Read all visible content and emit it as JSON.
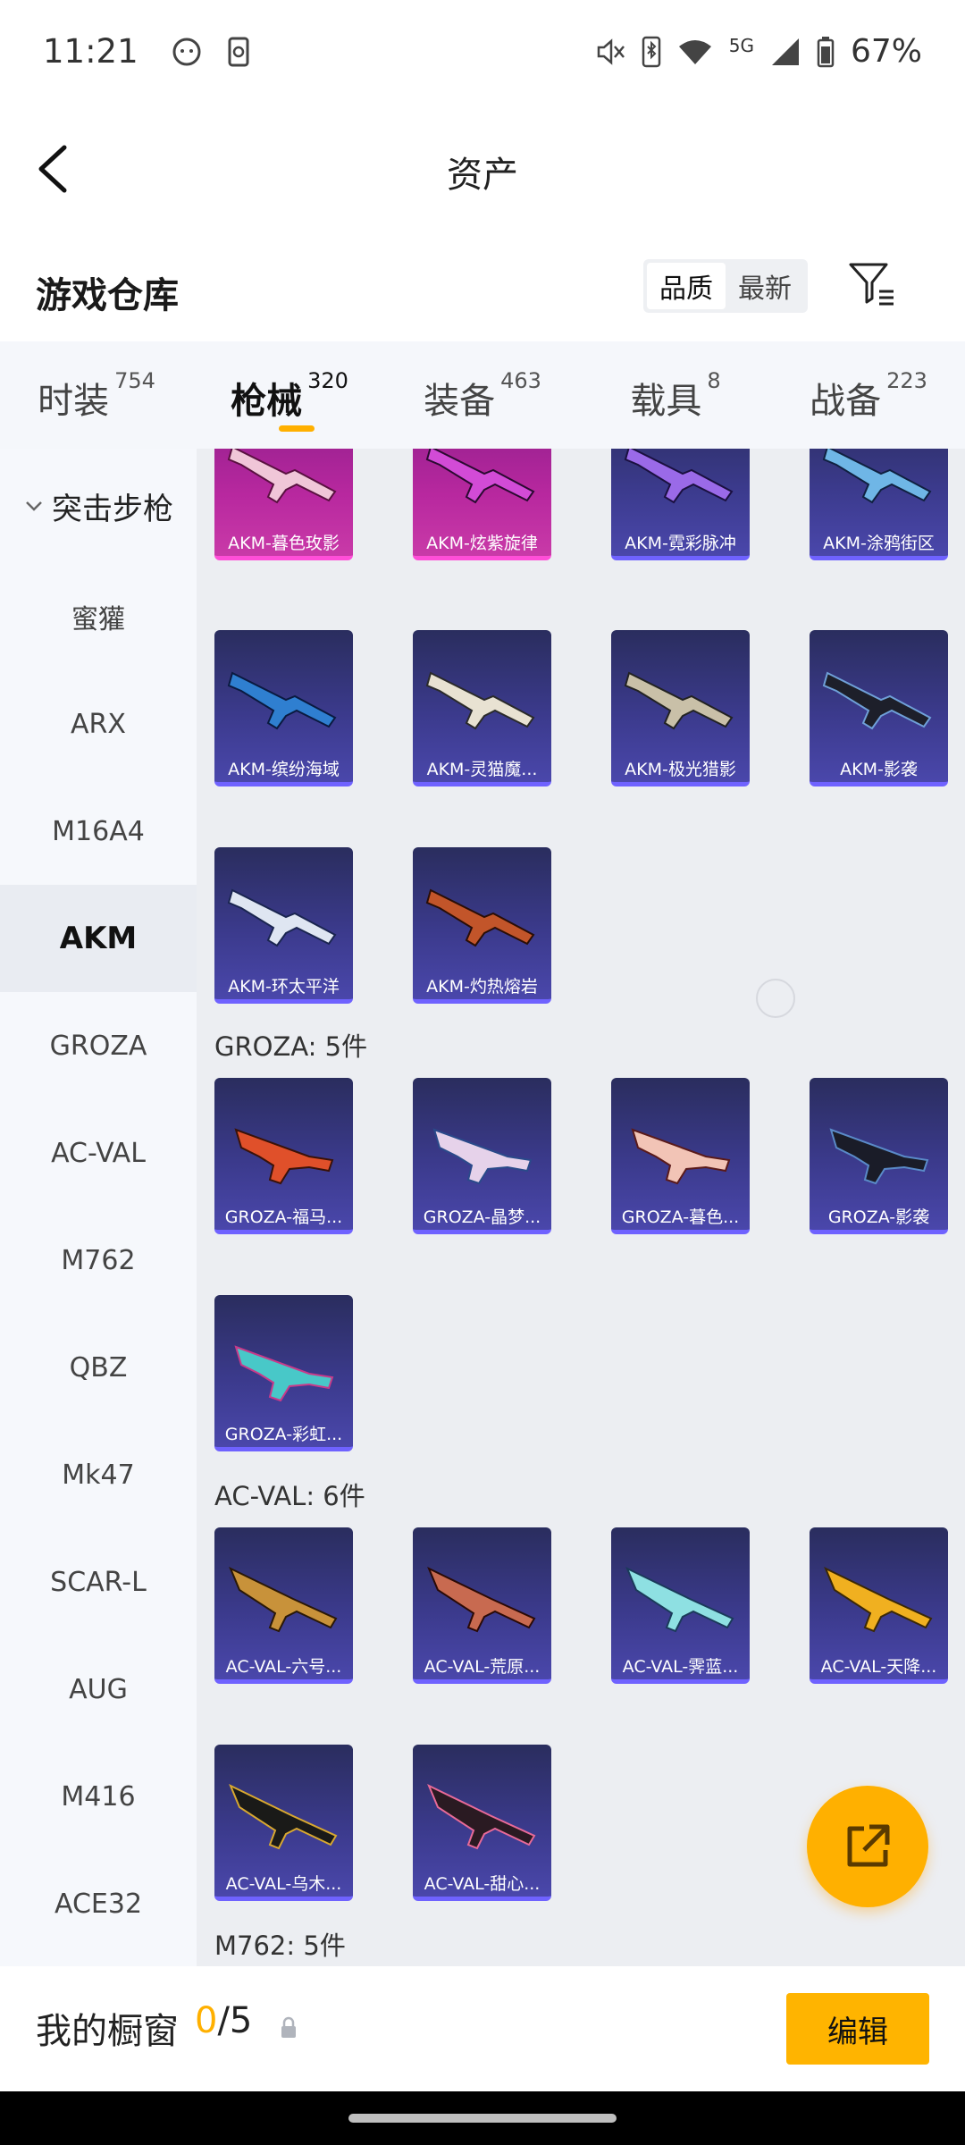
{
  "status_bar": {
    "time": "11:21",
    "network": "5G",
    "battery": "67%"
  },
  "header": {
    "title": "资产",
    "back_icon": "chevron-left-icon"
  },
  "warehouse": {
    "title": "游戏仓库",
    "sort_options": [
      "品质",
      "最新"
    ],
    "active_sort": "品质",
    "filter_icon": "filter-list-icon"
  },
  "tabs": [
    {
      "label": "时装",
      "count": "754"
    },
    {
      "label": "枪械",
      "count": "320",
      "active": true
    },
    {
      "label": "装备",
      "count": "463"
    },
    {
      "label": "载具",
      "count": "8"
    },
    {
      "label": "战备",
      "count": "223"
    }
  ],
  "sidebar": {
    "category": "突击步枪",
    "items": [
      "蜜獾",
      "ARX",
      "M16A4",
      "AKM",
      "GROZA",
      "AC-VAL",
      "M762",
      "QBZ",
      "Mk47",
      "SCAR-L",
      "AUG",
      "M416",
      "ACE32"
    ],
    "active": "AKM"
  },
  "content": {
    "akm_partial_row": [
      "AKM-暮色玫影",
      "AKM-炫紫旋律",
      "AKM-霓彩脉冲",
      "AKM-涂鸦街区"
    ],
    "akm_row2": [
      "AKM-缤纷海域",
      "AKM-灵猫魔...",
      "AKM-极光猎影",
      "AKM-影袭"
    ],
    "akm_row3": [
      "AKM-环太平洋",
      "AKM-灼热熔岩"
    ],
    "groza_title": "GROZA: 5件",
    "groza_row1": [
      "GROZA-福马...",
      "GROZA-晶梦...",
      "GROZA-暮色...",
      "GROZA-影袭"
    ],
    "groza_row2": [
      "GROZA-彩虹..."
    ],
    "acval_title": "AC-VAL: 6件",
    "acval_row1": [
      "AC-VAL-六号...",
      "AC-VAL-荒原...",
      "AC-VAL-霁蓝...",
      "AC-VAL-天降..."
    ],
    "acval_row2": [
      "AC-VAL-乌木...",
      "AC-VAL-甜心..."
    ],
    "m762_title": "M762: 5件"
  },
  "fab_icon": "share-external-icon",
  "bottom": {
    "label": "我的橱窗",
    "current": "0",
    "total": "/5",
    "lock_icon": "lock-icon",
    "edit_label": "编辑"
  },
  "colors": {
    "accent": "#ffb000",
    "card_purple": "#3b3a8c",
    "card_pink": "#b8289f"
  }
}
